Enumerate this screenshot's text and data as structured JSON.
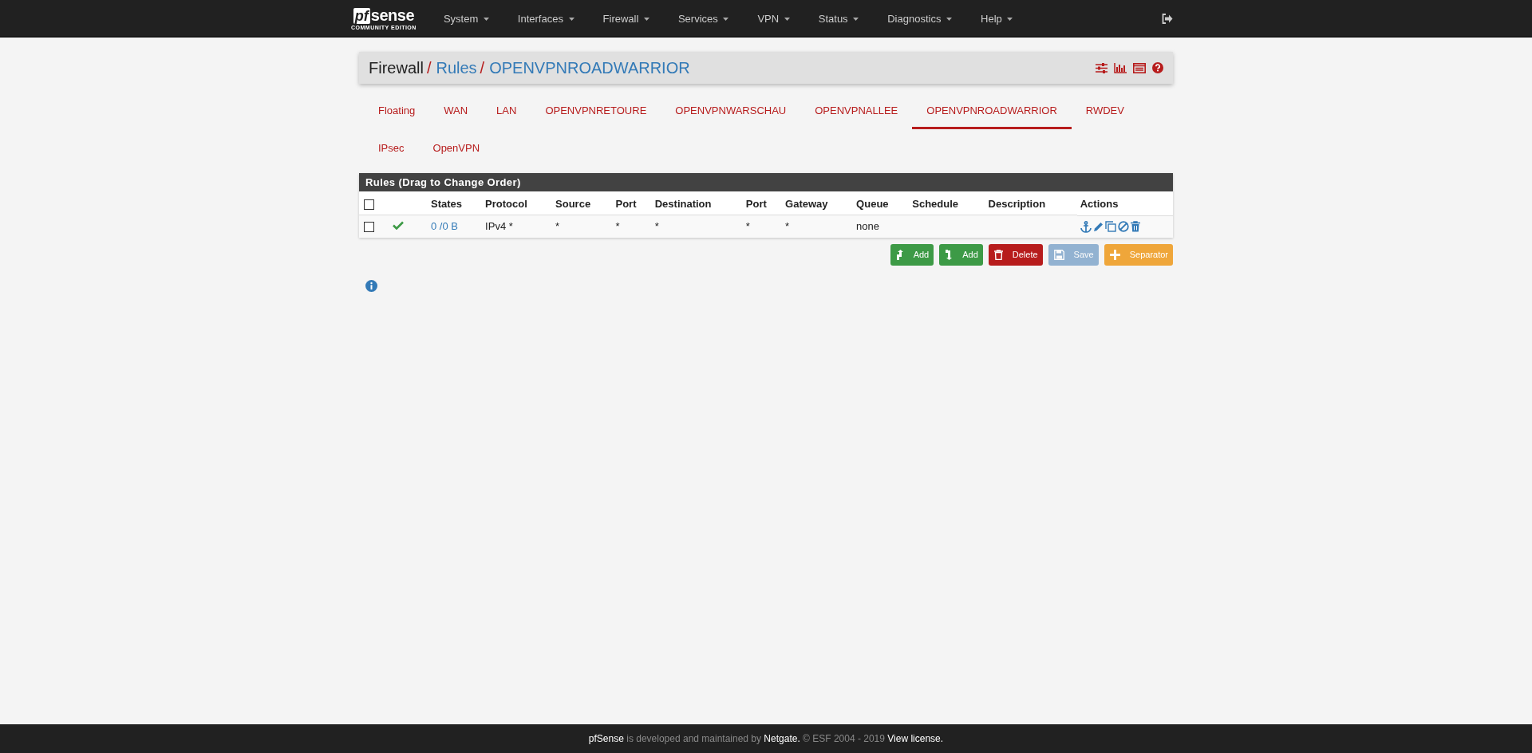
{
  "navbar": {
    "logo": {
      "mark": "pf",
      "word": "sense",
      "edition": "COMMUNITY EDITION"
    },
    "menus": [
      "System",
      "Interfaces",
      "Firewall",
      "Services",
      "VPN",
      "Status",
      "Diagnostics",
      "Help"
    ]
  },
  "breadcrumb": {
    "separator": "/",
    "items": [
      {
        "label": "Firewall",
        "link": false
      },
      {
        "label": "Rules",
        "link": true
      },
      {
        "label": "OPENVPNROADWARRIOR",
        "link": true
      }
    ]
  },
  "tabs": [
    {
      "label": "Floating",
      "selected": false
    },
    {
      "label": "WAN",
      "selected": false
    },
    {
      "label": "LAN",
      "selected": false
    },
    {
      "label": "OPENVPNRETOURE",
      "selected": false
    },
    {
      "label": "OPENVPNWARSCHAU",
      "selected": false
    },
    {
      "label": "OPENVPNALLEE",
      "selected": false
    },
    {
      "label": "OPENVPNROADWARRIOR",
      "selected": true
    },
    {
      "label": "RWDEV",
      "selected": false
    },
    {
      "label": "IPsec",
      "selected": false
    },
    {
      "label": "OpenVPN",
      "selected": false
    }
  ],
  "rules_panel": {
    "title": "Rules (Drag to Change Order)",
    "select_all_checked": false,
    "columns": [
      "States",
      "Protocol",
      "Source",
      "Port",
      "Destination",
      "Port",
      "Gateway",
      "Queue",
      "Schedule",
      "Description",
      "Actions"
    ],
    "rows": [
      {
        "checked": false,
        "enabled": true,
        "states": "0 /0 B",
        "protocol": "IPv4 *",
        "source": "*",
        "source_port": "*",
        "destination": "*",
        "destination_port": "*",
        "gateway": "*",
        "queue": "none"
      }
    ]
  },
  "buttons": [
    {
      "kind": "add-top",
      "label": "Add",
      "disabled": false
    },
    {
      "kind": "add-bottom",
      "label": "Add",
      "disabled": false
    },
    {
      "kind": "delete",
      "label": "Delete",
      "disabled": false
    },
    {
      "kind": "save",
      "label": "Save",
      "disabled": true
    },
    {
      "kind": "separator",
      "label": "Separator",
      "disabled": false
    }
  ],
  "footer": [
    {
      "kind": "brand",
      "text": "pfSense"
    },
    {
      "kind": "plain",
      "text": " is developed and maintained by "
    },
    {
      "kind": "link",
      "text": "Netgate."
    },
    {
      "kind": "plain",
      "text": " © ESF 2004 - 2019 "
    },
    {
      "kind": "link",
      "text": "View license."
    }
  ]
}
